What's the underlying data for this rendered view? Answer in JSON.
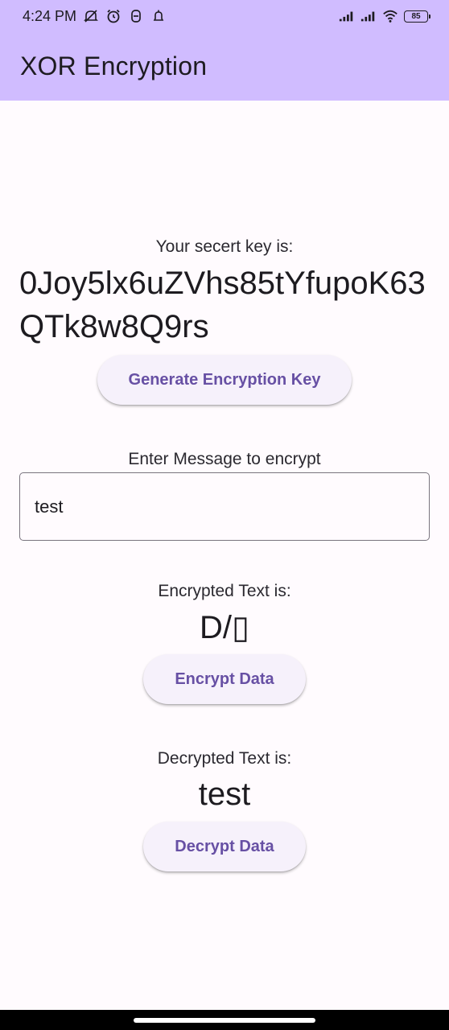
{
  "status_bar": {
    "time": "4:24 PM",
    "icons_left": [
      "mute-notification-icon",
      "alarm-icon",
      "app-notification-icon",
      "bell-icon"
    ],
    "icons_right": [
      "signal-icon",
      "signal-icon",
      "wifi-icon"
    ],
    "battery_level": "85"
  },
  "app_bar": {
    "title": "XOR Encryption"
  },
  "key_section": {
    "label": "Your secert key is:",
    "value": "0Joy5lx6uZVhs85tYfupoK63QTk8w8Q9rs",
    "button_label": "Generate Encryption Key"
  },
  "message_section": {
    "label": "Enter Message to encrypt",
    "input_value": "test"
  },
  "encrypted_section": {
    "label": "Encrypted Text is:",
    "value": "D/▯",
    "button_label": "Encrypt Data"
  },
  "decrypted_section": {
    "label": "Decrypted Text is:",
    "value": "test",
    "button_label": "Decrypt Data"
  },
  "colors": {
    "app_bar": "#d0bcff",
    "button_text": "#6750a4",
    "button_bg": "#f6f1fb"
  }
}
